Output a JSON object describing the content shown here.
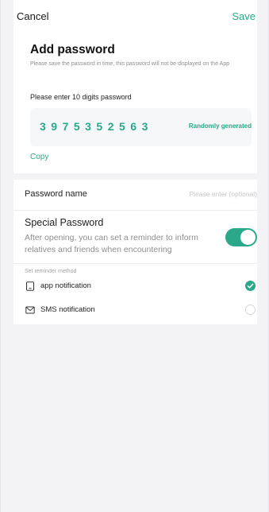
{
  "nav": {
    "cancel_label": "Cancel",
    "save_label": "Save"
  },
  "header": {
    "title": "Add password",
    "subtitle": "Please save the password in time, this password will not be displayed on the App"
  },
  "password": {
    "prompt": "Please enter 10 digits password",
    "digits": "3975352563",
    "random_label": "Randomly generated",
    "copy_label": "Copy"
  },
  "name_field": {
    "label": "Password name",
    "placeholder": "Please enter (optional)",
    "value": ""
  },
  "special": {
    "title": "Special Password",
    "description": "After opening, you can set a reminder to inform relatives and friends when encountering",
    "enabled": true
  },
  "reminder": {
    "header": "Set reminder method",
    "methods": [
      {
        "label": "app notification",
        "icon": "phone-icon",
        "selected": true
      },
      {
        "label": "SMS notification",
        "icon": "envelope-icon",
        "selected": false
      }
    ]
  },
  "colors": {
    "accent": "#2aa889",
    "background": "#f3f3f5"
  }
}
